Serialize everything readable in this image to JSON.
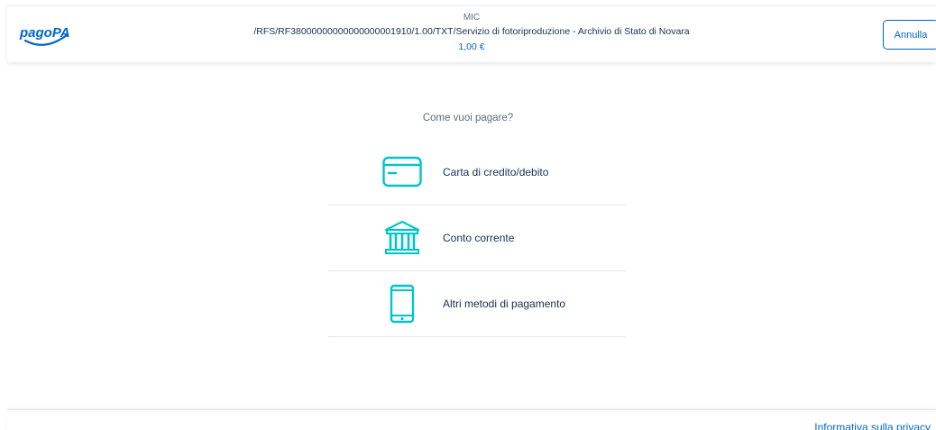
{
  "header": {
    "logo_text": "pagoPA",
    "payee": "MIC",
    "subject": "/RFS/RF38000000000000000001910/1.00/TXT/Servizio di fotoriproduzione - Archivio di Stato di Novara",
    "amount": "1,00 €",
    "cancel_label": "Annulla"
  },
  "main": {
    "question": "Come vuoi pagare?",
    "methods": [
      {
        "label": "Carta di credito/debito",
        "icon": "credit-card-icon"
      },
      {
        "label": "Conto corrente",
        "icon": "bank-icon"
      },
      {
        "label": "Altri metodi di pagamento",
        "icon": "smartphone-icon"
      }
    ]
  },
  "footer": {
    "privacy_link": "Informativa sulla privacy"
  },
  "colors": {
    "accent_blue": "#0066cc",
    "icon_teal": "#00c5ca",
    "text_dark": "#17324d",
    "text_muted": "#5c6f82"
  }
}
